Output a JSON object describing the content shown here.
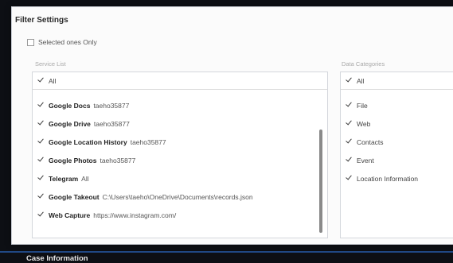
{
  "filter_settings": {
    "title": "Filter Settings",
    "selected_only_label": "Selected ones Only",
    "selected_only_checked": false
  },
  "service_list": {
    "label": "Service List",
    "all_label": "All",
    "all_checked": true,
    "items": [
      {
        "name": "Google Docs",
        "detail": "taeho35877",
        "checked": true
      },
      {
        "name": "Google Drive",
        "detail": "taeho35877",
        "checked": true
      },
      {
        "name": "Google Location History",
        "detail": "taeho35877",
        "checked": true
      },
      {
        "name": "Google Photos",
        "detail": "taeho35877",
        "checked": true
      },
      {
        "name": "Telegram",
        "detail": "All",
        "checked": true
      },
      {
        "name": "Google Takeout",
        "detail": "C:\\Users\\taeho\\OneDrive\\Documents\\records.json",
        "checked": true
      },
      {
        "name": "Web Capture",
        "detail": "https://www.instagram.com/",
        "checked": true
      }
    ]
  },
  "data_categories": {
    "label": "Data Categories",
    "all_label": "All",
    "all_checked": true,
    "items": [
      {
        "name": "File",
        "checked": true
      },
      {
        "name": "Web",
        "checked": true
      },
      {
        "name": "Contacts",
        "checked": true
      },
      {
        "name": "Event",
        "checked": true
      },
      {
        "name": "Location Information",
        "checked": true
      }
    ]
  },
  "case_information": {
    "title": "Case Information"
  }
}
